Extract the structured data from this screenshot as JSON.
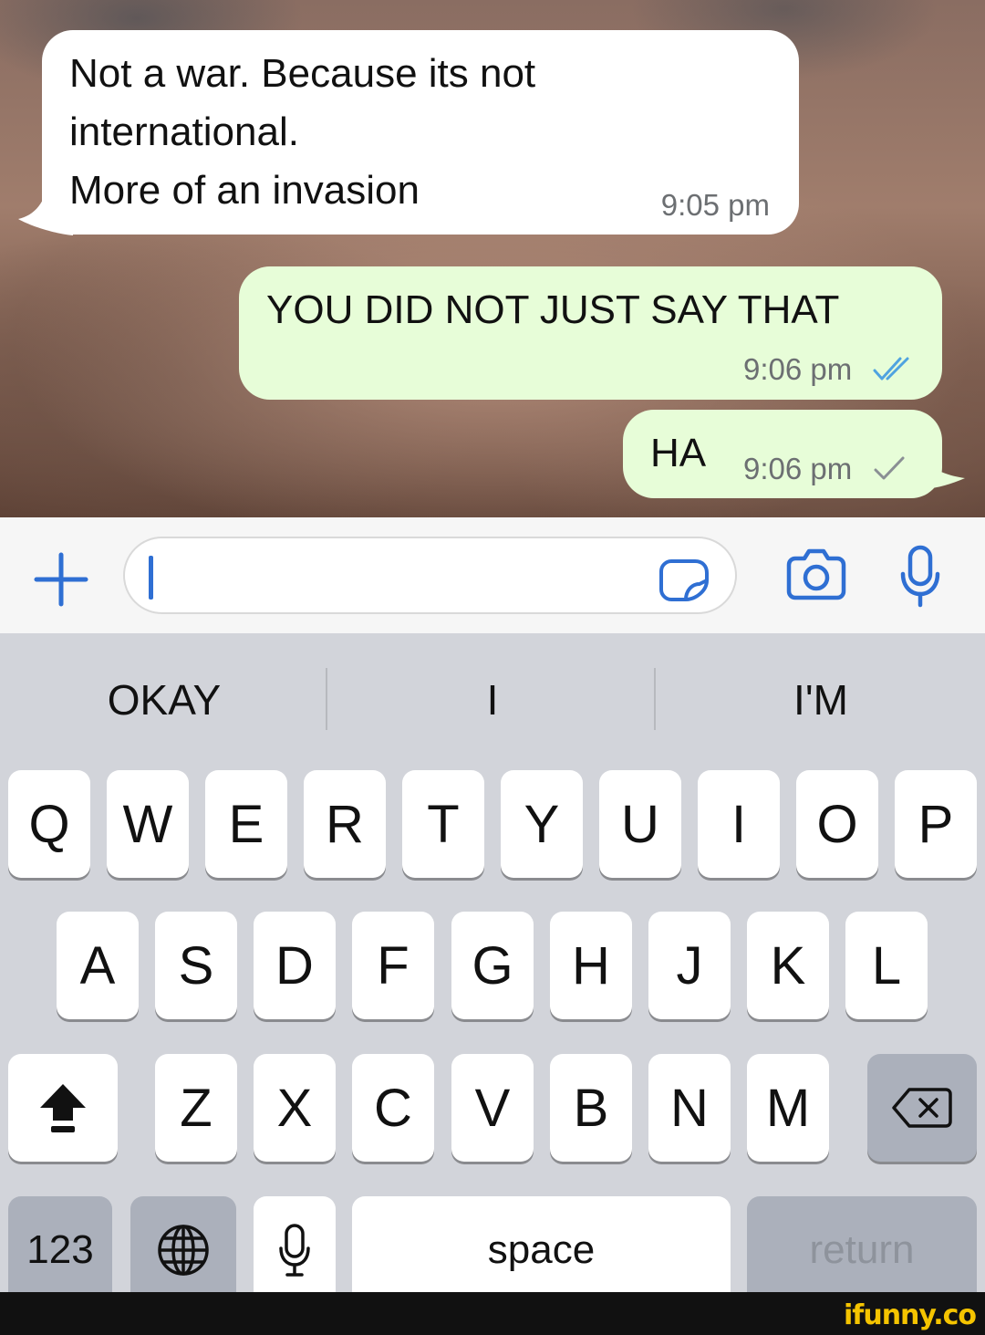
{
  "chat": {
    "messages": [
      {
        "direction": "incoming",
        "text": "Not a war. Because its not\ninternational.\nMore of an invasion",
        "time": "9:05 pm"
      },
      {
        "direction": "outgoing",
        "text": "YOU DID NOT JUST SAY THAT",
        "time": "9:06 pm",
        "status": "read-double-tick"
      },
      {
        "direction": "outgoing",
        "text": "HA",
        "time": "9:06 pm",
        "status": "sent-single-tick"
      }
    ]
  },
  "input_bar": {
    "add_icon": "plus-icon",
    "value": "",
    "sticker_icon": "sticker-icon",
    "camera_icon": "camera-icon",
    "mic_icon": "microphone-icon"
  },
  "keyboard": {
    "suggestions": [
      "OKAY",
      "I",
      "I'M"
    ],
    "row1": [
      "Q",
      "W",
      "E",
      "R",
      "T",
      "Y",
      "U",
      "I",
      "O",
      "P"
    ],
    "row2": [
      "A",
      "S",
      "D",
      "F",
      "G",
      "H",
      "J",
      "K",
      "L"
    ],
    "row3": [
      "Z",
      "X",
      "C",
      "V",
      "B",
      "N",
      "M"
    ],
    "shift_icon": "shift-icon",
    "backspace_icon": "backspace-icon",
    "numbers_label": "123",
    "globe_icon": "globe-icon",
    "dictation_icon": "microphone-icon",
    "space_label": "space",
    "return_label": "return"
  },
  "colors": {
    "incoming_bubble": "#ffffff",
    "outgoing_bubble": "#e7fdd8",
    "accent": "#2f6fd3",
    "read_tick": "#4fa3e0"
  },
  "watermark": "ifunny.co"
}
